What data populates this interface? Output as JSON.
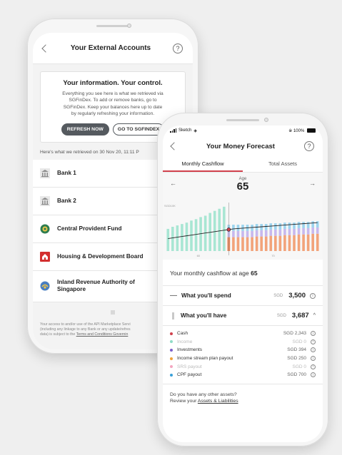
{
  "external": {
    "title": "Your External Accounts",
    "card_heading": "Your information. Your control.",
    "card_lines": [
      "Everything you see here is what we retrieved via",
      "SGFinDex. To add or remove banks, go to",
      "SGFinDex. Keep your balances here up to date",
      "by regularly refreshing your information."
    ],
    "refresh_label": "REFRESH NOW",
    "goto_label": "GO TO SGFINDEX",
    "retrieved_text": "Here's what we retrieved on 30 Nov 20, 11:11 P",
    "accounts": [
      {
        "label": "Bank 1",
        "icon": "bank-icon"
      },
      {
        "label": "Bank 2",
        "icon": "bank-icon"
      },
      {
        "label": "Central Provident Fund",
        "icon": "cpf-logo-icon"
      },
      {
        "label": "Housing & Development Board",
        "icon": "hdb-logo-icon"
      },
      {
        "label": "Inland Revenue Authority of",
        "label2": "Singapore",
        "icon": "iras-logo-icon"
      }
    ],
    "footer_lines": [
      "Your access to and/or use of the API Marketplace Servi",
      "(including any linkage to any Bank or any update/refres",
      "data) is subject to the"
    ],
    "footer_link": "Terms and Conditions Governin"
  },
  "forecast": {
    "status": {
      "carrier": "Sketch",
      "battery": "100%"
    },
    "title": "Your Money Forecast",
    "tabs": [
      "Monthly Cashflow",
      "Total Assets"
    ],
    "age_label": "Age",
    "age_value": "65",
    "summary_prefix": "Your monthly cashflow at age",
    "summary_age": "65",
    "spend": {
      "label": "What you'll spend",
      "currency": "SGD",
      "amount": "3,500"
    },
    "have": {
      "label": "What you'll have",
      "currency": "SGD",
      "amount": "3,687"
    },
    "breakdown": [
      {
        "name": "Cash",
        "value": "SGD 2,343",
        "color": "#d1414d",
        "muted": false
      },
      {
        "name": "Income",
        "value": "SGD 0",
        "color": "#8fdcc6",
        "muted": true
      },
      {
        "name": "Investments",
        "value": "SGD 394",
        "color": "#7b5fc9",
        "muted": false
      },
      {
        "name": "Income stream plan payout",
        "value": "SGD 250",
        "color": "#f0a23c",
        "muted": false
      },
      {
        "name": "SRS payout",
        "value": "SGD 0",
        "color": "#f4a6c0",
        "muted": true
      },
      {
        "name": "CPF payout",
        "value": "SGD 700",
        "color": "#3aa0d8",
        "muted": false
      }
    ],
    "assets_question": "Do you have any other assets?",
    "assets_prefix": "Review your",
    "assets_link": "Assets & Liabilities"
  },
  "chart_data": {
    "type": "bar",
    "title": "",
    "ylabel": "",
    "xlabel": "",
    "y_tick_label": "SGD10K",
    "x_tick_labels": [
      "60",
      "70"
    ],
    "highlight_index": 13,
    "series": [
      {
        "color": "#a8e6d3",
        "values": [
          3.2,
          3.5,
          3.7,
          3.9,
          4.1,
          4.4,
          4.6,
          4.9,
          5.1,
          5.5,
          5.8,
          6.1,
          6.4,
          0,
          0,
          0,
          0,
          0,
          0,
          0,
          0,
          0,
          0,
          0,
          0,
          0,
          0,
          0,
          0,
          0,
          0,
          0,
          0
        ]
      },
      {
        "color": "#f2a37a",
        "values": [
          0,
          0,
          0,
          0,
          0,
          0,
          0,
          0,
          0,
          0,
          0,
          0,
          0,
          2.0,
          2.0,
          2.0,
          2.0,
          2.0,
          2.0,
          2.1,
          2.1,
          2.1,
          2.2,
          2.2,
          2.2,
          2.3,
          2.3,
          2.3,
          2.4,
          2.4,
          2.4,
          2.5,
          2.5
        ]
      },
      {
        "color": "#c7b8ee",
        "values": [
          0,
          0,
          0,
          0,
          0,
          0,
          0,
          0,
          0,
          0,
          0,
          0,
          0,
          0.9,
          0.9,
          0.9,
          0.9,
          0.9,
          0.9,
          0.9,
          0.9,
          0.9,
          0.9,
          0.9,
          0.9,
          0.9,
          0.9,
          0.9,
          0.9,
          0.9,
          0.9,
          0.9,
          0.9
        ]
      },
      {
        "color": "#9cd4ee",
        "values": [
          0,
          0,
          0,
          0,
          0,
          0,
          0,
          0,
          0,
          0,
          0,
          0,
          0,
          0.9,
          0.9,
          0.9,
          0.9,
          0.9,
          0.9,
          0.9,
          0.9,
          0.9,
          0.9,
          0.9,
          0.9,
          0.9,
          0.9,
          0.9,
          0.9,
          0.9,
          0.9,
          0.9,
          0.9
        ]
      }
    ],
    "expense_line": [
      1.8,
      1.9,
      2.0,
      2.1,
      2.2,
      2.3,
      2.4,
      2.5,
      2.6,
      2.7,
      2.8,
      2.9,
      3.0,
      3.1,
      3.2,
      3.25,
      3.3,
      3.35,
      3.4,
      3.45,
      3.5,
      3.55,
      3.6,
      3.65,
      3.7,
      3.75,
      3.8,
      3.85,
      3.9,
      3.95,
      4.0,
      4.05,
      4.1
    ],
    "ylim": [
      0,
      7
    ]
  }
}
